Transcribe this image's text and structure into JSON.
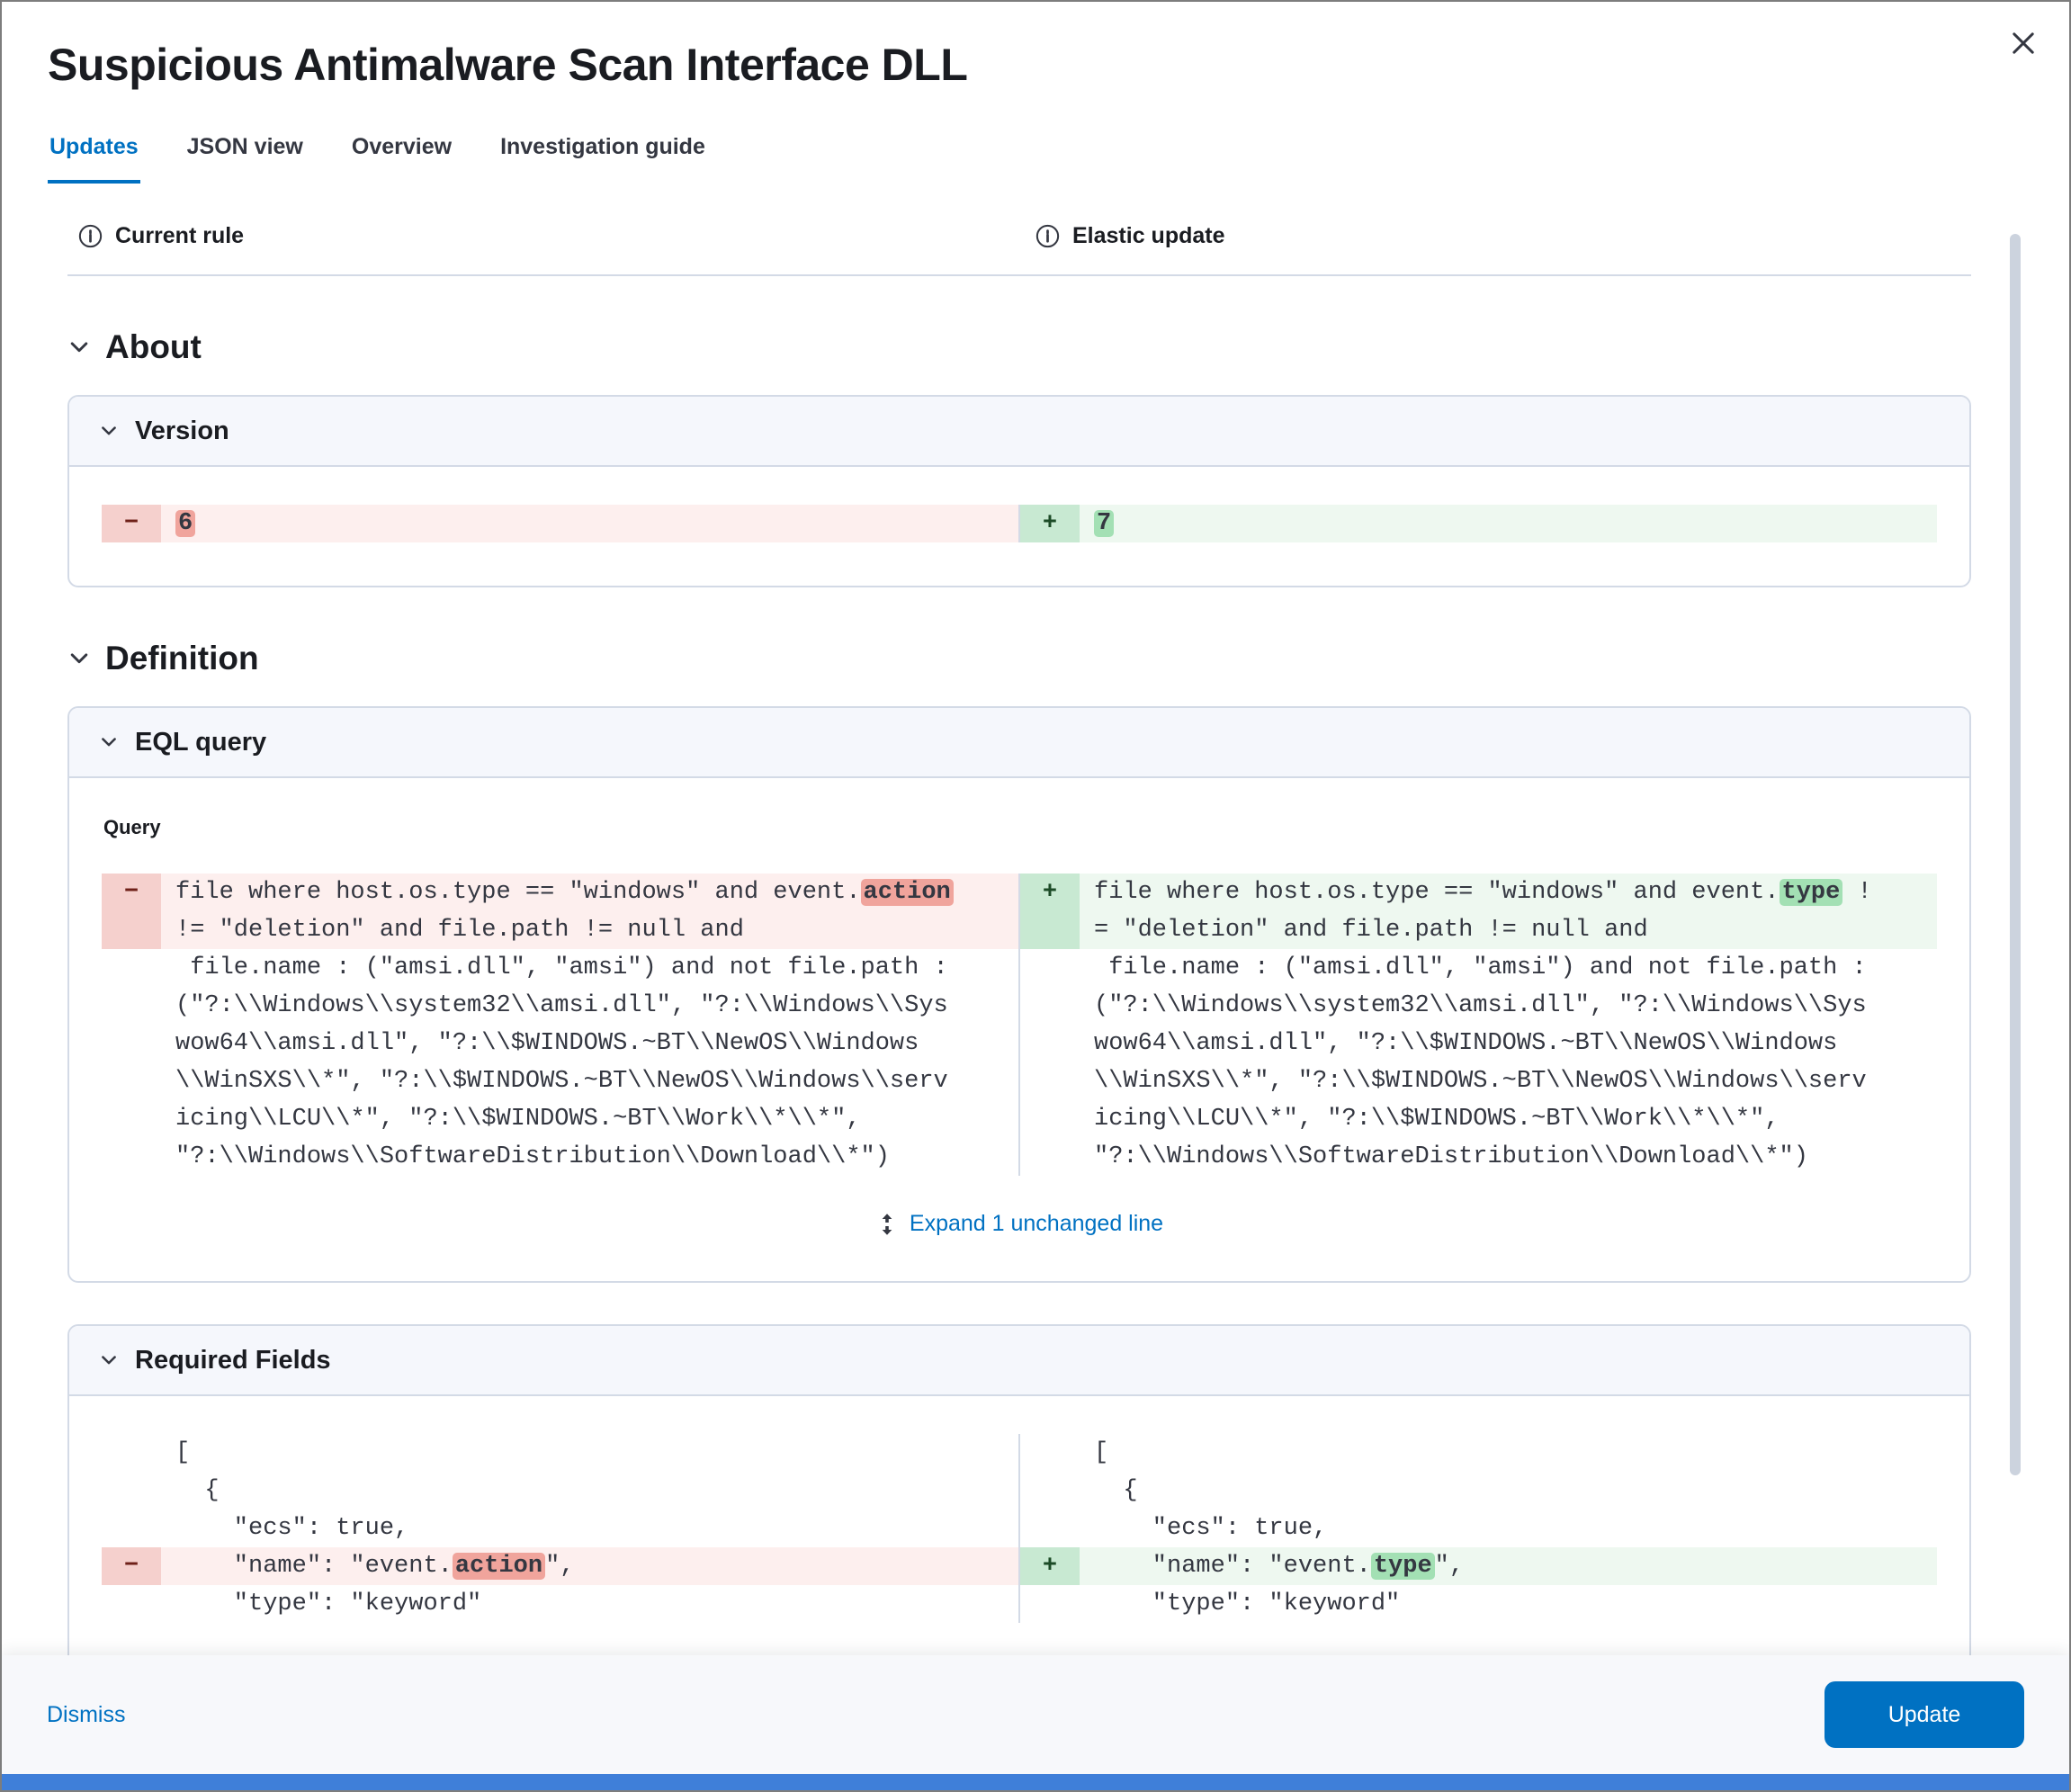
{
  "modal": {
    "title": "Suspicious Antimalware Scan Interface DLL"
  },
  "tabs": [
    {
      "label": "Updates",
      "active": true
    },
    {
      "label": "JSON view",
      "active": false
    },
    {
      "label": "Overview",
      "active": false
    },
    {
      "label": "Investigation guide",
      "active": false
    }
  ],
  "columns": {
    "left": "Current rule",
    "right": "Elastic update"
  },
  "sections": {
    "about": {
      "title": "About"
    },
    "definition": {
      "title": "Definition"
    }
  },
  "panels": {
    "version": {
      "title": "Version"
    },
    "eql": {
      "title": "EQL query",
      "query_label": "Query",
      "expand_label": "Expand 1 unchanged line"
    },
    "required_fields": {
      "title": "Required Fields"
    }
  },
  "diffs": {
    "version": {
      "left": [
        {
          "type": "del",
          "sign": "−",
          "seg": [
            {
              "hl": "6"
            }
          ]
        }
      ],
      "right": [
        {
          "type": "add",
          "sign": "+",
          "seg": [
            {
              "hl": "7"
            }
          ]
        }
      ]
    },
    "eql": {
      "left": [
        {
          "type": "del",
          "sign": "−",
          "seg": [
            "file where host.os.type == \"windows\" and event.",
            {
              "hl": "action"
            }
          ]
        },
        {
          "type": "del",
          "sign": "",
          "seg": [
            "!= \"deletion\" and file.path != null and"
          ]
        },
        {
          "type": "ctx",
          "sign": "",
          "seg": [
            " file.name : (\"amsi.dll\", \"amsi\") and not file.path :"
          ]
        },
        {
          "type": "ctx",
          "sign": "",
          "seg": [
            "(\"?:\\\\Windows\\\\system32\\\\amsi.dll\", \"?:\\\\Windows\\\\Sys"
          ]
        },
        {
          "type": "ctx",
          "sign": "",
          "seg": [
            "wow64\\\\amsi.dll\", \"?:\\\\$WINDOWS.~BT\\\\NewOS\\\\Windows"
          ]
        },
        {
          "type": "ctx",
          "sign": "",
          "seg": [
            "\\\\WinSXS\\\\*\", \"?:\\\\$WINDOWS.~BT\\\\NewOS\\\\Windows\\\\serv"
          ]
        },
        {
          "type": "ctx",
          "sign": "",
          "seg": [
            "icing\\\\LCU\\\\*\", \"?:\\\\$WINDOWS.~BT\\\\Work\\\\*\\\\*\","
          ]
        },
        {
          "type": "ctx",
          "sign": "",
          "seg": [
            "\"?:\\\\Windows\\\\SoftwareDistribution\\\\Download\\\\*\")"
          ]
        }
      ],
      "right": [
        {
          "type": "add",
          "sign": "+",
          "seg": [
            "file where host.os.type == \"windows\" and event.",
            {
              "hl": "type"
            },
            " !"
          ]
        },
        {
          "type": "add",
          "sign": "",
          "seg": [
            "= \"deletion\" and file.path != null and"
          ]
        },
        {
          "type": "ctx",
          "sign": "",
          "seg": [
            " file.name : (\"amsi.dll\", \"amsi\") and not file.path :"
          ]
        },
        {
          "type": "ctx",
          "sign": "",
          "seg": [
            "(\"?:\\\\Windows\\\\system32\\\\amsi.dll\", \"?:\\\\Windows\\\\Sys"
          ]
        },
        {
          "type": "ctx",
          "sign": "",
          "seg": [
            "wow64\\\\amsi.dll\", \"?:\\\\$WINDOWS.~BT\\\\NewOS\\\\Windows"
          ]
        },
        {
          "type": "ctx",
          "sign": "",
          "seg": [
            "\\\\WinSXS\\\\*\", \"?:\\\\$WINDOWS.~BT\\\\NewOS\\\\Windows\\\\serv"
          ]
        },
        {
          "type": "ctx",
          "sign": "",
          "seg": [
            "icing\\\\LCU\\\\*\", \"?:\\\\$WINDOWS.~BT\\\\Work\\\\*\\\\*\","
          ]
        },
        {
          "type": "ctx",
          "sign": "",
          "seg": [
            "\"?:\\\\Windows\\\\SoftwareDistribution\\\\Download\\\\*\")"
          ]
        }
      ]
    },
    "required_fields": {
      "left": [
        {
          "type": "ctx",
          "sign": "",
          "seg": [
            "["
          ]
        },
        {
          "type": "ctx",
          "sign": "",
          "seg": [
            "  {"
          ]
        },
        {
          "type": "ctx",
          "sign": "",
          "seg": [
            "    \"ecs\": true,"
          ]
        },
        {
          "type": "del",
          "sign": "−",
          "seg": [
            "    \"name\": \"event.",
            {
              "hl": "action"
            },
            "\","
          ]
        },
        {
          "type": "ctx",
          "sign": "",
          "seg": [
            "    \"type\": \"keyword\""
          ]
        }
      ],
      "right": [
        {
          "type": "ctx",
          "sign": "",
          "seg": [
            "["
          ]
        },
        {
          "type": "ctx",
          "sign": "",
          "seg": [
            "  {"
          ]
        },
        {
          "type": "ctx",
          "sign": "",
          "seg": [
            "    \"ecs\": true,"
          ]
        },
        {
          "type": "add",
          "sign": "+",
          "seg": [
            "    \"name\": \"event.",
            {
              "hl": "type"
            },
            "\","
          ]
        },
        {
          "type": "ctx",
          "sign": "",
          "seg": [
            "    \"type\": \"keyword\""
          ]
        }
      ]
    }
  },
  "footer": {
    "dismiss": "Dismiss",
    "update": "Update"
  },
  "colors": {
    "primary": "#0071c2",
    "heading_text": "#1a1c21",
    "body_text": "#343741",
    "border": "#d3dae6",
    "panel_header_bg": "#f5f7fc",
    "removed_line_bg": "#fdefee",
    "removed_gutter_bg": "#f5d0cd",
    "removed_highlight_bg": "#f0a49c",
    "added_line_bg": "#eef8f0",
    "added_gutter_bg": "#c8e9d2",
    "added_highlight_bg": "#a3e0b4",
    "footer_bg": "#f7f8fb",
    "bottom_strip": "#3f7fd9"
  }
}
